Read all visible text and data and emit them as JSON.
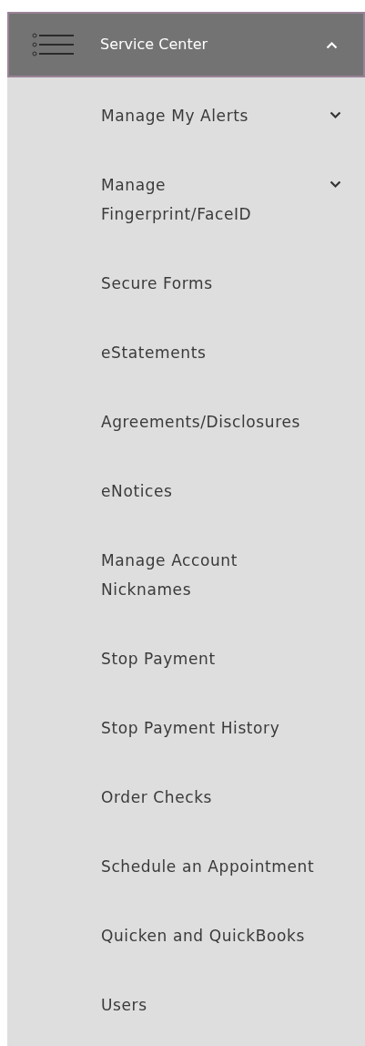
{
  "header": {
    "title": "Service Center",
    "expanded": true
  },
  "items": [
    {
      "label": "Manage My Alerts",
      "kind": "expandable",
      "expanded": false
    },
    {
      "label": "Manage Fingerprint/FaceID",
      "kind": "expandable",
      "expanded": false
    },
    {
      "label": "Secure Forms",
      "kind": "link"
    },
    {
      "label": "eStatements",
      "kind": "link"
    },
    {
      "label": "Agreements/Disclosures",
      "kind": "link"
    },
    {
      "label": "eNotices",
      "kind": "link"
    },
    {
      "label": "Manage Account Nicknames",
      "kind": "link"
    },
    {
      "label": "Stop Payment",
      "kind": "link"
    },
    {
      "label": "Stop Payment History",
      "kind": "link"
    },
    {
      "label": "Order Checks",
      "kind": "link"
    },
    {
      "label": "Schedule an Appointment",
      "kind": "link"
    },
    {
      "label": "Quicken and QuickBooks",
      "kind": "link"
    },
    {
      "label": "Users",
      "kind": "link"
    }
  ]
}
